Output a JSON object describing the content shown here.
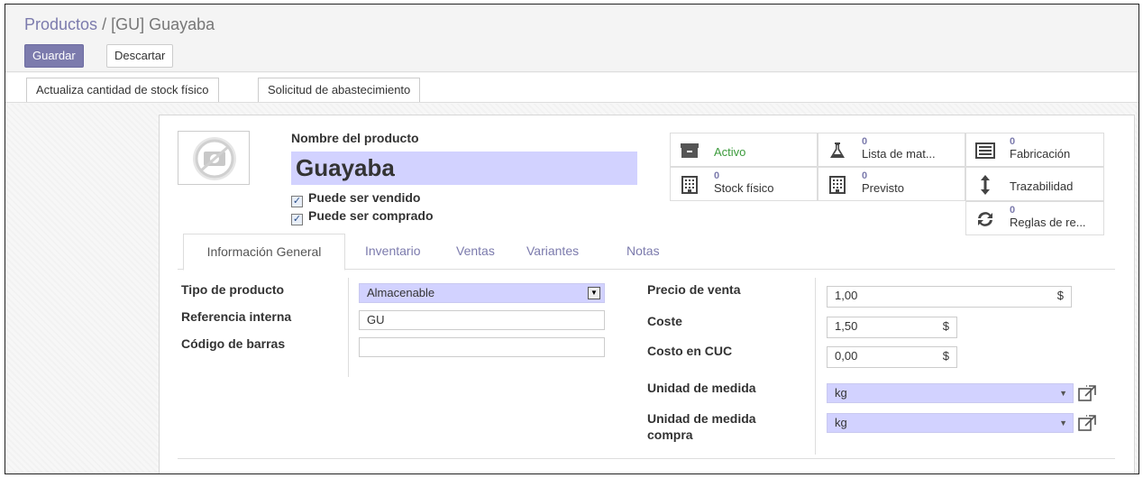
{
  "breadcrumb": {
    "parent": "Productos",
    "separator": "/",
    "current": "[GU] Guayaba"
  },
  "toolbar": {
    "save_label": "Guardar",
    "discard_label": "Descartar"
  },
  "statusbar": {
    "update_stock_label": "Actualiza cantidad de stock físico",
    "procurement_label": "Solicitud de abastecimiento"
  },
  "product": {
    "name_label": "Nombre del producto",
    "name_value": "Guayaba",
    "sale_ok_label": "Puede ser vendido",
    "sale_ok": true,
    "purchase_ok_label": "Puede ser comprado",
    "purchase_ok": true
  },
  "smart_buttons": {
    "active": {
      "label": "Activo"
    },
    "bom": {
      "count": "0",
      "label": "Lista de mat..."
    },
    "manufacturing": {
      "count": "0",
      "label": "Fabricación"
    },
    "stock": {
      "count": "0",
      "label": "Stock físico"
    },
    "forecast": {
      "count": "0",
      "label": "Previsto"
    },
    "traceability": {
      "label": "Trazabilidad"
    },
    "rules": {
      "count": "0",
      "label": "Reglas de re..."
    }
  },
  "tabs": [
    {
      "label": "Información General"
    },
    {
      "label": "Inventario"
    },
    {
      "label": "Ventas"
    },
    {
      "label": "Variantes"
    },
    {
      "label": "Notas"
    }
  ],
  "general": {
    "type_label": "Tipo de producto",
    "type_value": "Almacenable",
    "ref_label": "Referencia interna",
    "ref_value": "GU",
    "barcode_label": "Código de barras",
    "barcode_value": "",
    "price_label": "Precio de venta",
    "price_value": "1,00",
    "cost_label": "Coste",
    "cost_value": "1,50",
    "cuc_label": "Costo en CUC",
    "cuc_value": "0,00",
    "currency": "$",
    "uom_label": "Unidad de medida",
    "uom_value": "kg",
    "uom_po_label_1": "Unidad de medida",
    "uom_po_label_2": "compra",
    "uom_po_value": "kg"
  },
  "colors": {
    "accent": "#7c7bad",
    "required_bg": "#d2d2ff",
    "active_green": "#3c9b3c"
  }
}
